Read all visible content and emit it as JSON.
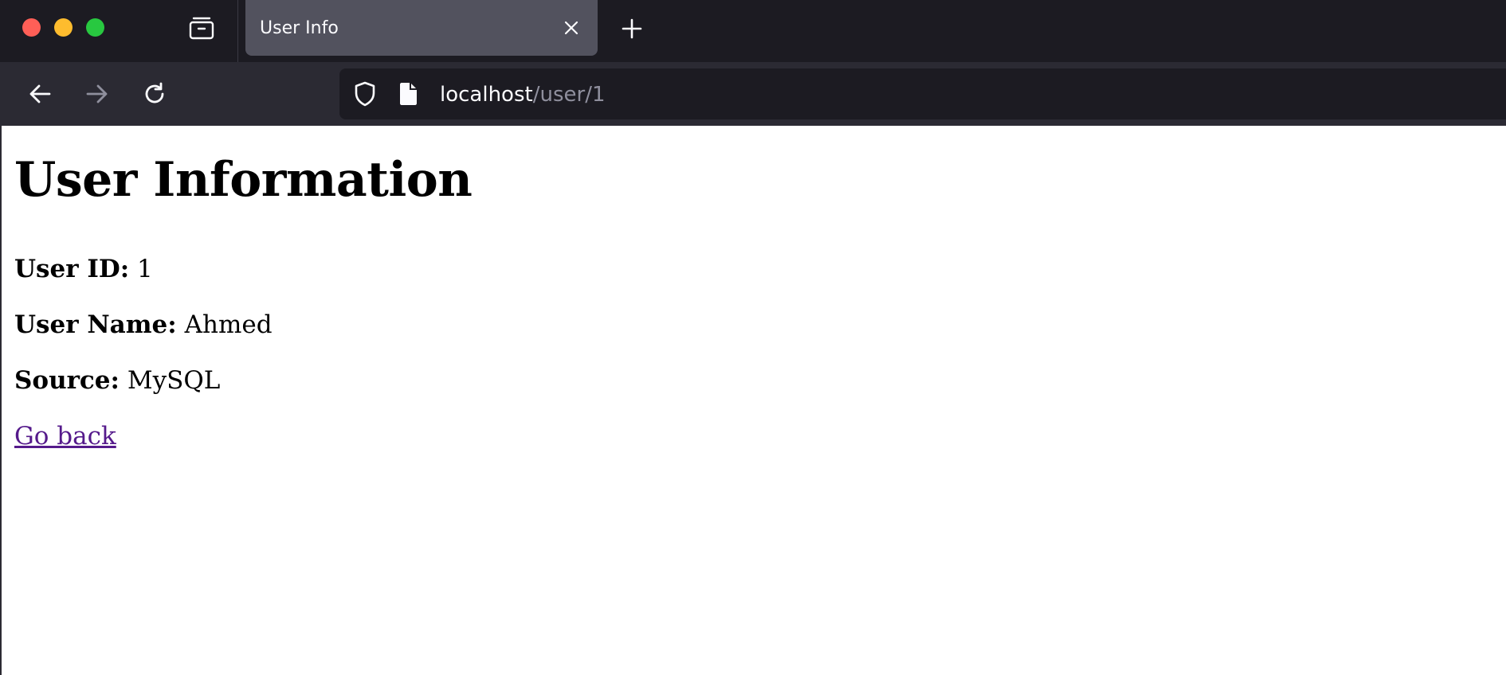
{
  "browser": {
    "tab": {
      "title": "User Info"
    },
    "url": {
      "host": "localhost",
      "path": "/user/1"
    },
    "icons": {
      "collections": "collections-icon",
      "tab_close": "close-icon",
      "new_tab": "plus-icon",
      "back": "arrow-left-icon",
      "forward": "arrow-right-icon",
      "reload": "reload-icon",
      "shield": "shield-icon",
      "page": "page-icon"
    },
    "colors": {
      "titlebar": "#1c1b22",
      "toolbar": "#2b2a33",
      "active_tab": "#52525e",
      "close_red": "#ff5f57",
      "minimize_yellow": "#febc2e",
      "zoom_green": "#28c840"
    }
  },
  "page": {
    "heading": "User Information",
    "fields": [
      {
        "label": "User ID:",
        "value": "1"
      },
      {
        "label": "User Name:",
        "value": "Ahmed"
      },
      {
        "label": "Source:",
        "value": "MySQL"
      }
    ],
    "back_link": "Go back",
    "link_color": "#551a8b"
  }
}
